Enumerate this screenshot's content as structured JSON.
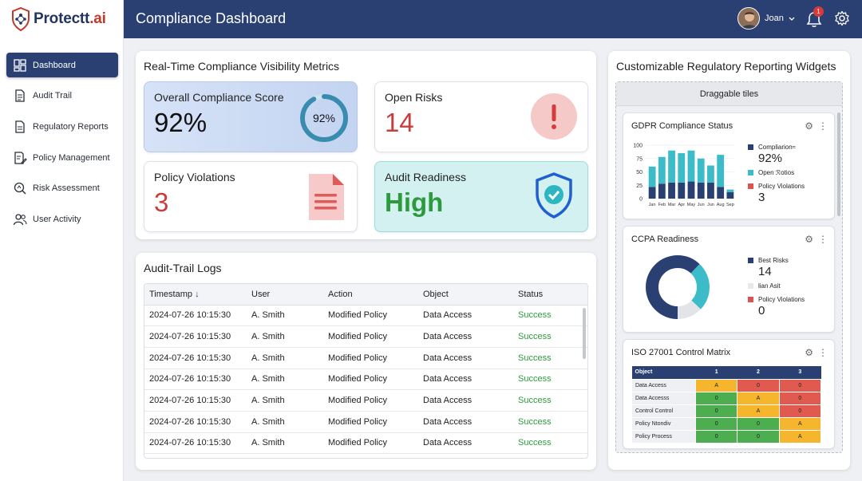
{
  "app": {
    "name_main": "Protectt",
    "name_suffix": ".ai",
    "page_title": "Compliance Dashboard"
  },
  "user": {
    "name": "Joan",
    "notifications": "1"
  },
  "nav": [
    {
      "label": "Dashboard",
      "icon": "dashboard-icon",
      "active": true
    },
    {
      "label": "Audit Trail",
      "icon": "document-icon"
    },
    {
      "label": "Regulatory Reports",
      "icon": "report-icon"
    },
    {
      "label": "Policy Management",
      "icon": "policy-edit-icon"
    },
    {
      "label": "Risk Assessment",
      "icon": "risk-search-icon"
    },
    {
      "label": "User Activity",
      "icon": "users-icon"
    }
  ],
  "metrics": {
    "title": "Real-Time Compliance Visibility Metrics",
    "compliance": {
      "label": "Overall Compliance Score",
      "value": "92%",
      "gauge_label": "92%",
      "gauge_fraction": 0.92
    },
    "risks": {
      "label": "Open Risks",
      "value": "14"
    },
    "violations": {
      "label": "Policy Violations",
      "value": "3"
    },
    "readiness": {
      "label": "Audit Readiness",
      "value": "High"
    }
  },
  "logs": {
    "title": "Audit-Trail Logs",
    "columns": [
      "Timestamp",
      "User",
      "Action",
      "Object",
      "Status"
    ],
    "rows": [
      [
        "2024-07-26 10:15:30",
        "A. Smith",
        "Modified Policy",
        "Data Access",
        "Success"
      ],
      [
        "2024-07-26 10:15:30",
        "A. Smith",
        "Modified Policy",
        "Data Access",
        "Success"
      ],
      [
        "2024-07-26 10:15:30",
        "A. Smith",
        "Modified Policy",
        "Data Access",
        "Success"
      ],
      [
        "2024-07-26 10:15:30",
        "A. Smith",
        "Modified Policy",
        "Data Access",
        "Success"
      ],
      [
        "2024-07-26 10:15:30",
        "A. Smith",
        "Modified Policy",
        "Data Access",
        "Success"
      ],
      [
        "2024-07-26 10:15:30",
        "A. Smith",
        "Modified Policy",
        "Data Access",
        "Success"
      ],
      [
        "2024-07-26 10:15:30",
        "A. Smith",
        "Modified Policy",
        "Data Access",
        "Success"
      ]
    ]
  },
  "widgets": {
    "title": "Customizable Regulatory Reporting Widgets",
    "drag_label": "Draggable tiles",
    "gdpr": {
      "title": "GDPR Compliance Status",
      "legend": [
        {
          "label": "Compliarion≈",
          "value": "92%",
          "color": "#2b4072"
        },
        {
          "label": "Open ℛotios",
          "color": "#3bbcc8"
        },
        {
          "label": "Policy Violations",
          "value": "3",
          "color": "#d9534f"
        }
      ]
    },
    "ccpa": {
      "title": "CCPA Readiness",
      "legend": [
        {
          "label": "Best Risks",
          "value": "14",
          "color": "#2b4072"
        },
        {
          "label": "Ɩian Asit",
          "color": "#e6e8ec"
        },
        {
          "label": "Policy Violations",
          "value": "0",
          "color": "#d9534f"
        }
      ]
    },
    "iso": {
      "title": "ISO 27001 Control Matrix",
      "header": [
        "Object",
        "1",
        "2",
        "3"
      ],
      "rows": [
        [
          "Data Access",
          "A",
          "0",
          "0"
        ],
        [
          "Data Accesss",
          "0",
          "A",
          "0"
        ],
        [
          "Control Control",
          "0",
          "A",
          "0"
        ],
        [
          "Policy Ntondiv",
          "0",
          "0",
          "A"
        ],
        [
          "Policy Process",
          "0",
          "0",
          "A"
        ]
      ],
      "colors": [
        [
          "#f5b52c",
          "#e05a4f",
          "#e05a4f"
        ],
        [
          "#4cae4f",
          "#f5b52c",
          "#e05a4f"
        ],
        [
          "#4cae4f",
          "#f5b52c",
          "#e05a4f"
        ],
        [
          "#4cae4f",
          "#4cae4f",
          "#f5b52c"
        ],
        [
          "#4cae4f",
          "#4cae4f",
          "#f5b52c"
        ]
      ]
    }
  },
  "chart_data": [
    {
      "type": "bar",
      "title": "GDPR Compliance Status",
      "categories": [
        "Jan",
        "Feb",
        "Mar",
        "Apr",
        "May",
        "Jun",
        "Jun",
        "Aug",
        "Sep"
      ],
      "series": [
        {
          "values": [
            22,
            28,
            30,
            30,
            32,
            30,
            30,
            22,
            12
          ],
          "color": "#2b4072"
        },
        {
          "values": [
            38,
            50,
            60,
            55,
            58,
            45,
            32,
            60,
            5
          ],
          "color": "#3bbcc8"
        },
        {
          "values": [
            0,
            0,
            0,
            0,
            0,
            0,
            0,
            0,
            0
          ],
          "color": "#d9534f"
        }
      ],
      "yticks": [
        "100",
        "75",
        "50",
        "25",
        "0"
      ],
      "ylim": [
        0,
        100
      ]
    },
    {
      "type": "pie",
      "title": "CCPA Readiness",
      "values": [
        62,
        25,
        13
      ],
      "colors": [
        "#2b4072",
        "#3bbcc8",
        "#e2e4e8"
      ]
    }
  ]
}
